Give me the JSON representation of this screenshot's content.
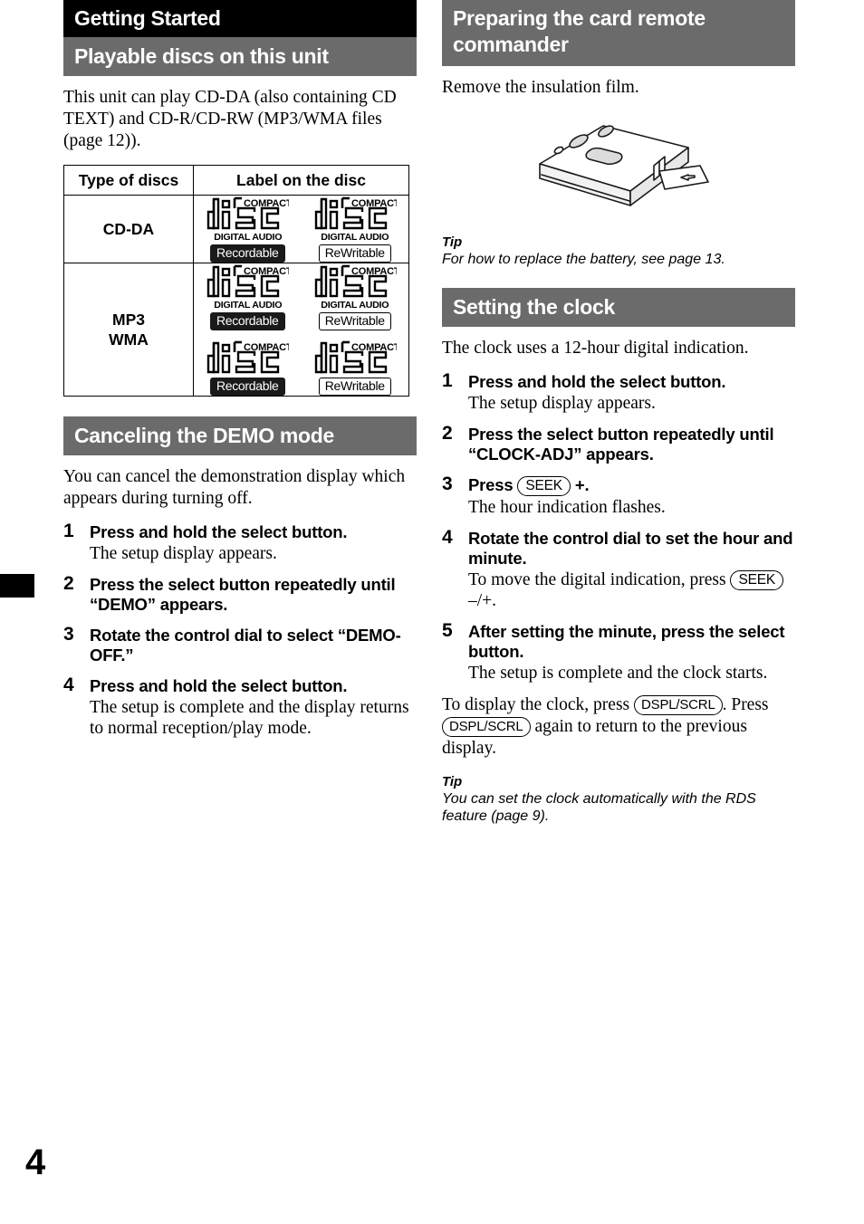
{
  "page": {
    "folio": "4",
    "colors": {
      "banner_black": "#000000",
      "banner_gray": "#6b6b6b",
      "text": "#000000"
    }
  },
  "left_column": {
    "chapter_banner": "Getting Started",
    "section1": {
      "heading": "Playable discs on this unit",
      "intro": "This unit can play CD-DA (also containing CD TEXT) and CD-R/CD-RW (MP3/WMA files (page 12)).",
      "table": {
        "headers": [
          "Type of discs",
          "Label on the disc"
        ],
        "rows": [
          {
            "type": "CD-DA",
            "logo_groups": [
              [
                {
                  "top": "COMPACT",
                  "mark": "disc",
                  "audio": "DIGITAL AUDIO",
                  "badge": "Recordable",
                  "badge_style": "filled"
                },
                {
                  "top": "COMPACT",
                  "mark": "disc",
                  "audio": "DIGITAL AUDIO",
                  "badge": "ReWritable",
                  "badge_style": "outline"
                }
              ]
            ]
          },
          {
            "type": "MP3\nWMA",
            "type_lines": [
              "MP3",
              "WMA"
            ],
            "logo_groups": [
              [
                {
                  "top": "COMPACT",
                  "mark": "disc",
                  "audio": "DIGITAL AUDIO",
                  "badge": "Recordable",
                  "badge_style": "filled"
                },
                {
                  "top": "COMPACT",
                  "mark": "disc",
                  "audio": "DIGITAL AUDIO",
                  "badge": "ReWritable",
                  "badge_style": "outline"
                }
              ],
              [
                {
                  "top": "COMPACT",
                  "mark": "disc",
                  "audio": "",
                  "badge": "Recordable",
                  "badge_style": "filled"
                },
                {
                  "top": "COMPACT",
                  "mark": "disc",
                  "audio": "",
                  "badge": "ReWritable",
                  "badge_style": "outline"
                }
              ]
            ]
          }
        ]
      }
    },
    "section2": {
      "heading": "Canceling the DEMO mode",
      "intro": "You can cancel the demonstration display which appears during turning off.",
      "steps": [
        {
          "num": "1",
          "title": "Press and hold the select button.",
          "desc": "The setup display appears."
        },
        {
          "num": "2",
          "title": "Press the select button repeatedly until “DEMO” appears.",
          "desc": ""
        },
        {
          "num": "3",
          "title": "Rotate the control dial to select “DEMO-OFF.”",
          "desc": ""
        },
        {
          "num": "4",
          "title": "Press and hold the select button.",
          "desc": "The setup is complete and the display returns to normal reception/play mode."
        }
      ]
    }
  },
  "right_column": {
    "section1": {
      "heading": "Preparing the card remote commander",
      "intro": "Remove the insulation film.",
      "figure_name": "card-remote-commander-illustration",
      "tip_label": "Tip",
      "tip_text": "For how to replace the battery, see page 13."
    },
    "section2": {
      "heading": "Setting the clock",
      "intro": "The clock uses a 12-hour digital indication.",
      "steps": [
        {
          "num": "1",
          "title": "Press and hold the select button.",
          "desc": "The setup display appears."
        },
        {
          "num": "2",
          "title": "Press the select button repeatedly until “CLOCK-ADJ” appears.",
          "desc": ""
        },
        {
          "num": "3",
          "title_pre": "Press ",
          "key": "SEEK",
          "title_post": " +.",
          "desc": "The hour indication flashes."
        },
        {
          "num": "4",
          "title": "Rotate the control dial to set the hour and minute.",
          "desc_pre": "To move the digital indication, press ",
          "key": "SEEK",
          "desc_post": " –/+."
        },
        {
          "num": "5",
          "title": "After setting the minute, press the select button.",
          "desc": "The setup is complete and the clock starts."
        }
      ],
      "closing": {
        "pre": "To display the clock, press ",
        "key1": "DSPL/SCRL",
        "mid": ". Press ",
        "key2": "DSPL/SCRL",
        "post": " again to return to the previous display."
      },
      "tip_label": "Tip",
      "tip_text": "You can set the clock automatically with the RDS feature (page 9)."
    }
  }
}
